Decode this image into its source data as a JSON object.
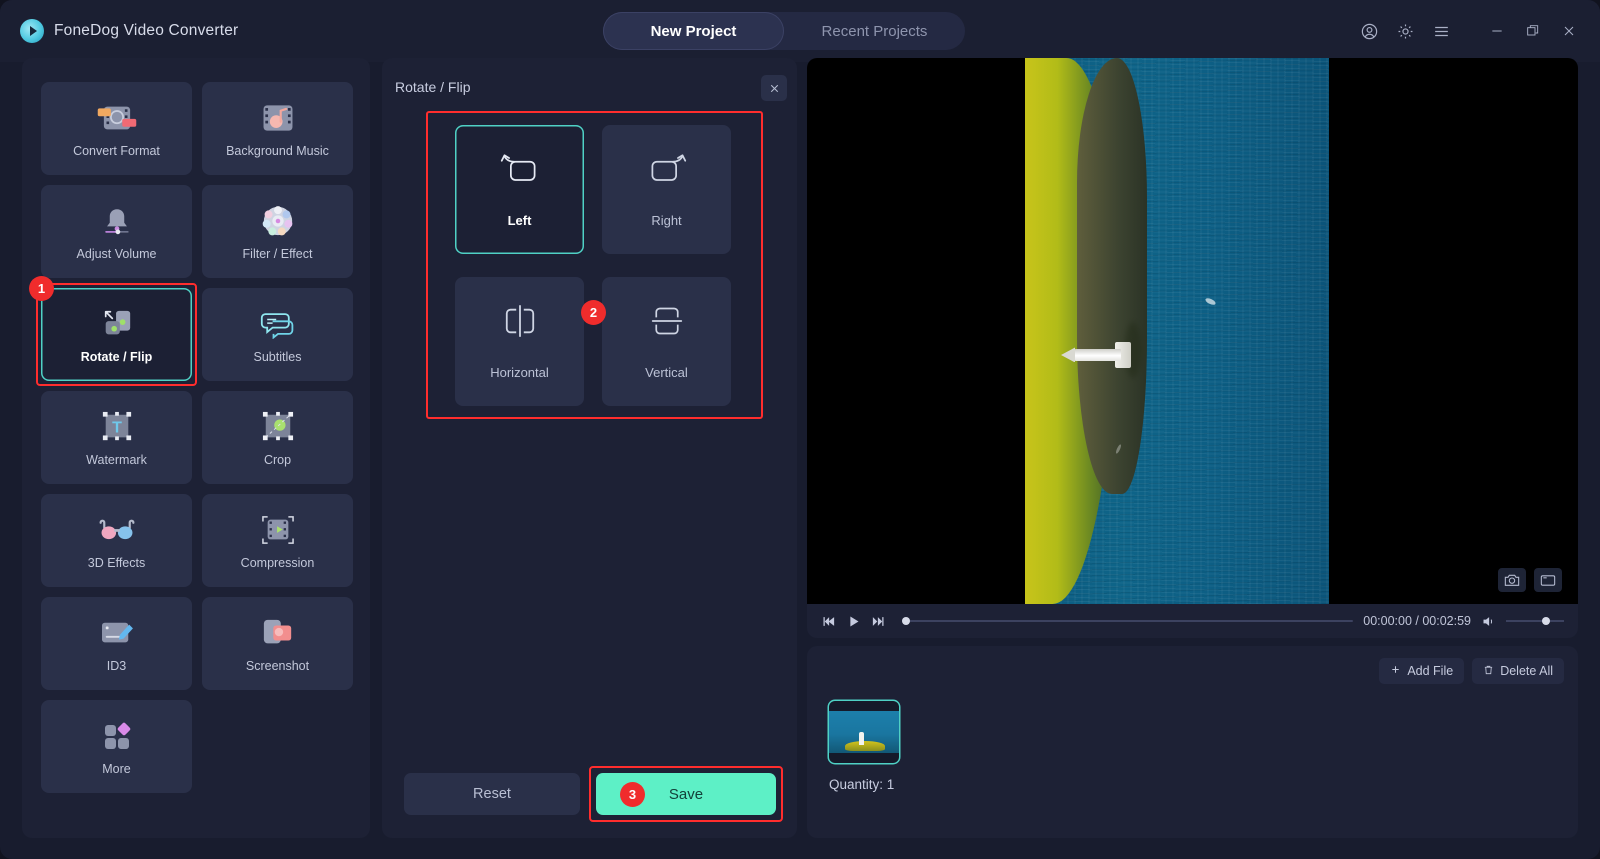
{
  "app": {
    "brand_name": "FoneDog Video Converter",
    "logo_icon": "play-circle-icon"
  },
  "titlebar": {
    "tabs": [
      {
        "label": "New Project",
        "active": true
      },
      {
        "label": "Recent Projects",
        "active": false
      }
    ],
    "controls": [
      {
        "name": "account-icon",
        "glyph": "account"
      },
      {
        "name": "gear-icon",
        "glyph": "gear"
      },
      {
        "name": "menu-icon",
        "glyph": "menu"
      },
      {
        "name": "minimize-icon",
        "glyph": "minimize"
      },
      {
        "name": "maximize-icon",
        "glyph": "maximize"
      },
      {
        "name": "close-icon",
        "glyph": "close"
      }
    ]
  },
  "sidebar": {
    "tools": [
      {
        "label": "Convert Format",
        "icon": "convert-format-icon",
        "selected": false
      },
      {
        "label": "Background Music",
        "icon": "background-music-icon",
        "selected": false
      },
      {
        "label": "Adjust Volume",
        "icon": "adjust-volume-icon",
        "selected": false
      },
      {
        "label": "Filter / Effect",
        "icon": "filter-effect-icon",
        "selected": false
      },
      {
        "label": "Rotate / Flip",
        "icon": "rotate-flip-icon",
        "selected": true,
        "badge": "1"
      },
      {
        "label": "Subtitles",
        "icon": "subtitles-icon",
        "selected": false
      },
      {
        "label": "Watermark",
        "icon": "watermark-icon",
        "selected": false
      },
      {
        "label": "Crop",
        "icon": "crop-icon",
        "selected": false
      },
      {
        "label": "3D Effects",
        "icon": "3d-effects-icon",
        "selected": false
      },
      {
        "label": "Compression",
        "icon": "compression-icon",
        "selected": false
      },
      {
        "label": "ID3",
        "icon": "id3-icon",
        "selected": false
      },
      {
        "label": "Screenshot",
        "icon": "screenshot-icon",
        "selected": false
      },
      {
        "label": "More",
        "icon": "more-icon",
        "selected": false
      }
    ]
  },
  "rotate_panel": {
    "title": "Rotate / Flip",
    "close_icon": "close-icon",
    "group_badge": "2",
    "options": [
      {
        "label": "Left",
        "icon": "rotate-left-icon",
        "selected": true
      },
      {
        "label": "Right",
        "icon": "rotate-right-icon",
        "selected": false
      },
      {
        "label": "Horizontal",
        "icon": "flip-horizontal-icon",
        "selected": false
      },
      {
        "label": "Vertical",
        "icon": "flip-vertical-icon",
        "selected": false
      }
    ],
    "reset_label": "Reset",
    "save_label": "Save",
    "save_badge": "3",
    "accent_color": "#5df0c6",
    "highlight_color": "#ff2d2d",
    "selected_border_color": "#4fd1c5"
  },
  "preview": {
    "current_time": "00:00:00",
    "total_time": "00:02:59",
    "time_display": "00:00:00 / 00:02:59",
    "snapshot_icon": "camera-icon",
    "fullscreen_icon": "fullscreen-icon",
    "prev_icon": "skip-previous-icon",
    "play_icon": "play-icon",
    "next_icon": "skip-next-icon",
    "volume_icon": "volume-icon"
  },
  "filelist": {
    "add_file_label": "Add File",
    "add_file_icon": "plus-icon",
    "delete_all_label": "Delete All",
    "delete_all_icon": "trash-icon",
    "quantity_label": "Quantity: 1"
  }
}
